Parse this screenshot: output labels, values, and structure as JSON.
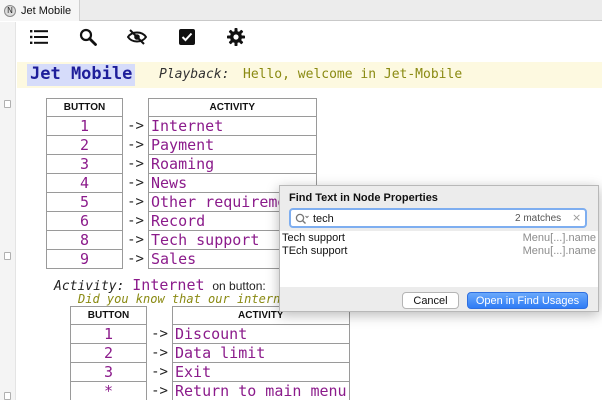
{
  "tab": {
    "icon_letter": "N",
    "title": "Jet Mobile",
    "close_glyph": "×"
  },
  "toolbar": {
    "icons": [
      "list-icon",
      "search-icon",
      "hide-icon",
      "checkbox-icon",
      "gear-icon"
    ]
  },
  "header": {
    "app_name": "Jet Mobile",
    "playback_label": "Playback:",
    "playback_value": "Hello, welcome in Jet-Mobile"
  },
  "main_menu": {
    "headers": [
      "BUTTON",
      "ACTIVITY"
    ],
    "arrow": "->",
    "rows": [
      {
        "button": "1",
        "activity": "Internet"
      },
      {
        "button": "2",
        "activity": "Payment"
      },
      {
        "button": "3",
        "activity": "Roaming"
      },
      {
        "button": "4",
        "activity": "News"
      },
      {
        "button": "5",
        "activity": "Other requirements"
      },
      {
        "button": "6",
        "activity": "Record"
      },
      {
        "button": "8",
        "activity": "Tech support"
      },
      {
        "button": "9",
        "activity": "Sales"
      }
    ]
  },
  "activity_section": {
    "label": "Activity:",
    "name": "Internet",
    "on_button": "on button:",
    "hint": "Did you know that our interne"
  },
  "sub_menu": {
    "headers": [
      "BUTTON",
      "ACTIVITY"
    ],
    "arrow": "->",
    "rows": [
      {
        "button": "1",
        "activity": "Discount"
      },
      {
        "button": "2",
        "activity": "Data limit"
      },
      {
        "button": "3",
        "activity": "Exit"
      },
      {
        "button": "*",
        "activity": "Return to main menu"
      }
    ]
  },
  "find_dialog": {
    "title": "Find Text in Node Properties",
    "query": "tech",
    "matches": "2 matches",
    "clear_glyph": "×",
    "results": [
      {
        "name": "Tech support",
        "path": "Menu[...].name"
      },
      {
        "name": "TEch support",
        "path": "Menu[...].name"
      }
    ],
    "cancel_label": "Cancel",
    "ok_label": "Open in Find Usages"
  },
  "colors": {
    "accent_blue": "#2f7cf5",
    "string_olive": "#8a8a12",
    "keyword_purple": "#8b1b8b",
    "name_highlight": "#d6dcfa"
  }
}
